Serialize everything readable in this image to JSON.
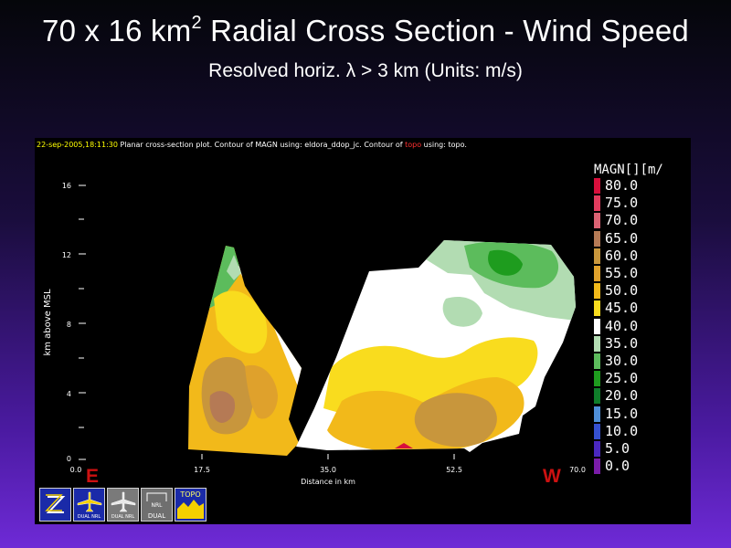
{
  "slide": {
    "title_main": "70 x 16 km",
    "title_sup": "2",
    "title_rest": " Radial Cross Section - Wind Speed",
    "subtitle": "Resolved horiz. λ > 3 km (Units:  m/s)"
  },
  "plot": {
    "header_date": "22-sep-2005,18:11:30",
    "header_a": "  Planar cross-section plot.  Contour of MAGN using: eldora_ddop_jc.  Contour of ",
    "header_topo": "topo",
    "header_b": " using: topo.",
    "ylabel": "km above MSL",
    "xlabel": "Distance in km",
    "y_ticks": [
      "0",
      "4",
      "8",
      "12",
      "16"
    ],
    "x_ticks": [
      "0.0",
      "17.5",
      "35.0",
      "52.5",
      "70.0"
    ],
    "east_label": "E",
    "west_label": "W"
  },
  "legend": {
    "title": "MAGN[][m/",
    "levels": [
      {
        "label": "80.0",
        "color": "#d80f3c"
      },
      {
        "label": "75.0",
        "color": "#e23c5e"
      },
      {
        "label": "70.0",
        "color": "#da6273"
      },
      {
        "label": "65.0",
        "color": "#b57a55"
      },
      {
        "label": "60.0",
        "color": "#c8963c"
      },
      {
        "label": "55.0",
        "color": "#dfa12c"
      },
      {
        "label": "50.0",
        "color": "#f2b91a"
      },
      {
        "label": "45.0",
        "color": "#f9dc1e"
      },
      {
        "label": "40.0",
        "color": "#ffffff"
      },
      {
        "label": "35.0",
        "color": "#b2dcb2"
      },
      {
        "label": "30.0",
        "color": "#5cbc5c"
      },
      {
        "label": "25.0",
        "color": "#1e9c1e"
      },
      {
        "label": "20.0",
        "color": "#0f7d2a"
      },
      {
        "label": "15.0",
        "color": "#4f8fd8"
      },
      {
        "label": "10.0",
        "color": "#3550d0"
      },
      {
        "label": "5.0",
        "color": "#4a28c0"
      },
      {
        "label": "0.0",
        "color": "#7a1ca8"
      }
    ]
  },
  "toolbar": {
    "tool_z_icon": "zoom-z-icon",
    "tool_dual_nrl_caption": "DUAL NRL",
    "tool_dual_nrl2_caption": "DUAL NRL",
    "tool_nrl_dual_caption": "DUAL",
    "tool_nrl_dual_top": "NRL",
    "tool_topo_caption": "TOPO"
  },
  "colors": {
    "slide_text": "#ffffff",
    "ew_marker": "#cc1111",
    "panel_bg": "#000000"
  }
}
